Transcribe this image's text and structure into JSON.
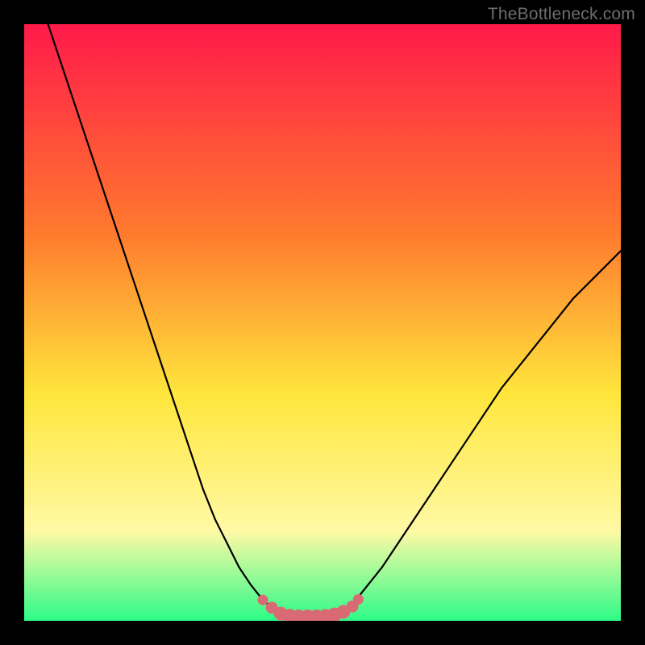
{
  "watermark": "TheBottleneck.com",
  "colors": {
    "background": "#000000",
    "gradient_top": "#ff1a4a",
    "gradient_mid_upper": "#ff7a2e",
    "gradient_mid": "#ffe63c",
    "gradient_mid_lower": "#fff9a5",
    "gradient_bottom": "#2dfb88",
    "curve": "#000000",
    "marker_fill": "#d96a74",
    "marker_stroke": "#d96a74"
  },
  "chart_data": {
    "type": "line",
    "title": "",
    "xlabel": "",
    "ylabel": "",
    "xlim": [
      0,
      100
    ],
    "ylim": [
      0,
      100
    ],
    "series": [
      {
        "name": "bottleneck-curve",
        "x": [
          4,
          6,
          8,
          10,
          12,
          14,
          16,
          18,
          20,
          22,
          24,
          26,
          28,
          30,
          32,
          34,
          36,
          38,
          40,
          42,
          44,
          46,
          48,
          50,
          52,
          54,
          56,
          58,
          60,
          64,
          68,
          72,
          76,
          80,
          84,
          88,
          92,
          96,
          100
        ],
        "y": [
          100,
          94,
          88,
          82,
          76,
          70,
          64,
          58,
          52,
          46,
          40,
          34,
          28,
          22,
          17,
          13,
          9,
          6,
          3.5,
          1.8,
          1.0,
          0.6,
          0.6,
          0.6,
          1.0,
          2.0,
          4.0,
          6.5,
          9.0,
          15,
          21,
          27,
          33,
          39,
          44,
          49,
          54,
          58,
          62
        ]
      }
    ],
    "markers": {
      "name": "optimal-range",
      "x": [
        40,
        41.5,
        43,
        44.5,
        46,
        47.5,
        49,
        50.5,
        52,
        53.5,
        55,
        56
      ],
      "y": [
        3.5,
        2.2,
        1.2,
        0.8,
        0.6,
        0.6,
        0.6,
        0.7,
        1.0,
        1.5,
        2.4,
        3.6
      ],
      "radius": [
        6,
        7,
        8,
        8.5,
        9,
        9,
        9,
        9,
        8.5,
        8,
        7,
        6
      ]
    }
  }
}
